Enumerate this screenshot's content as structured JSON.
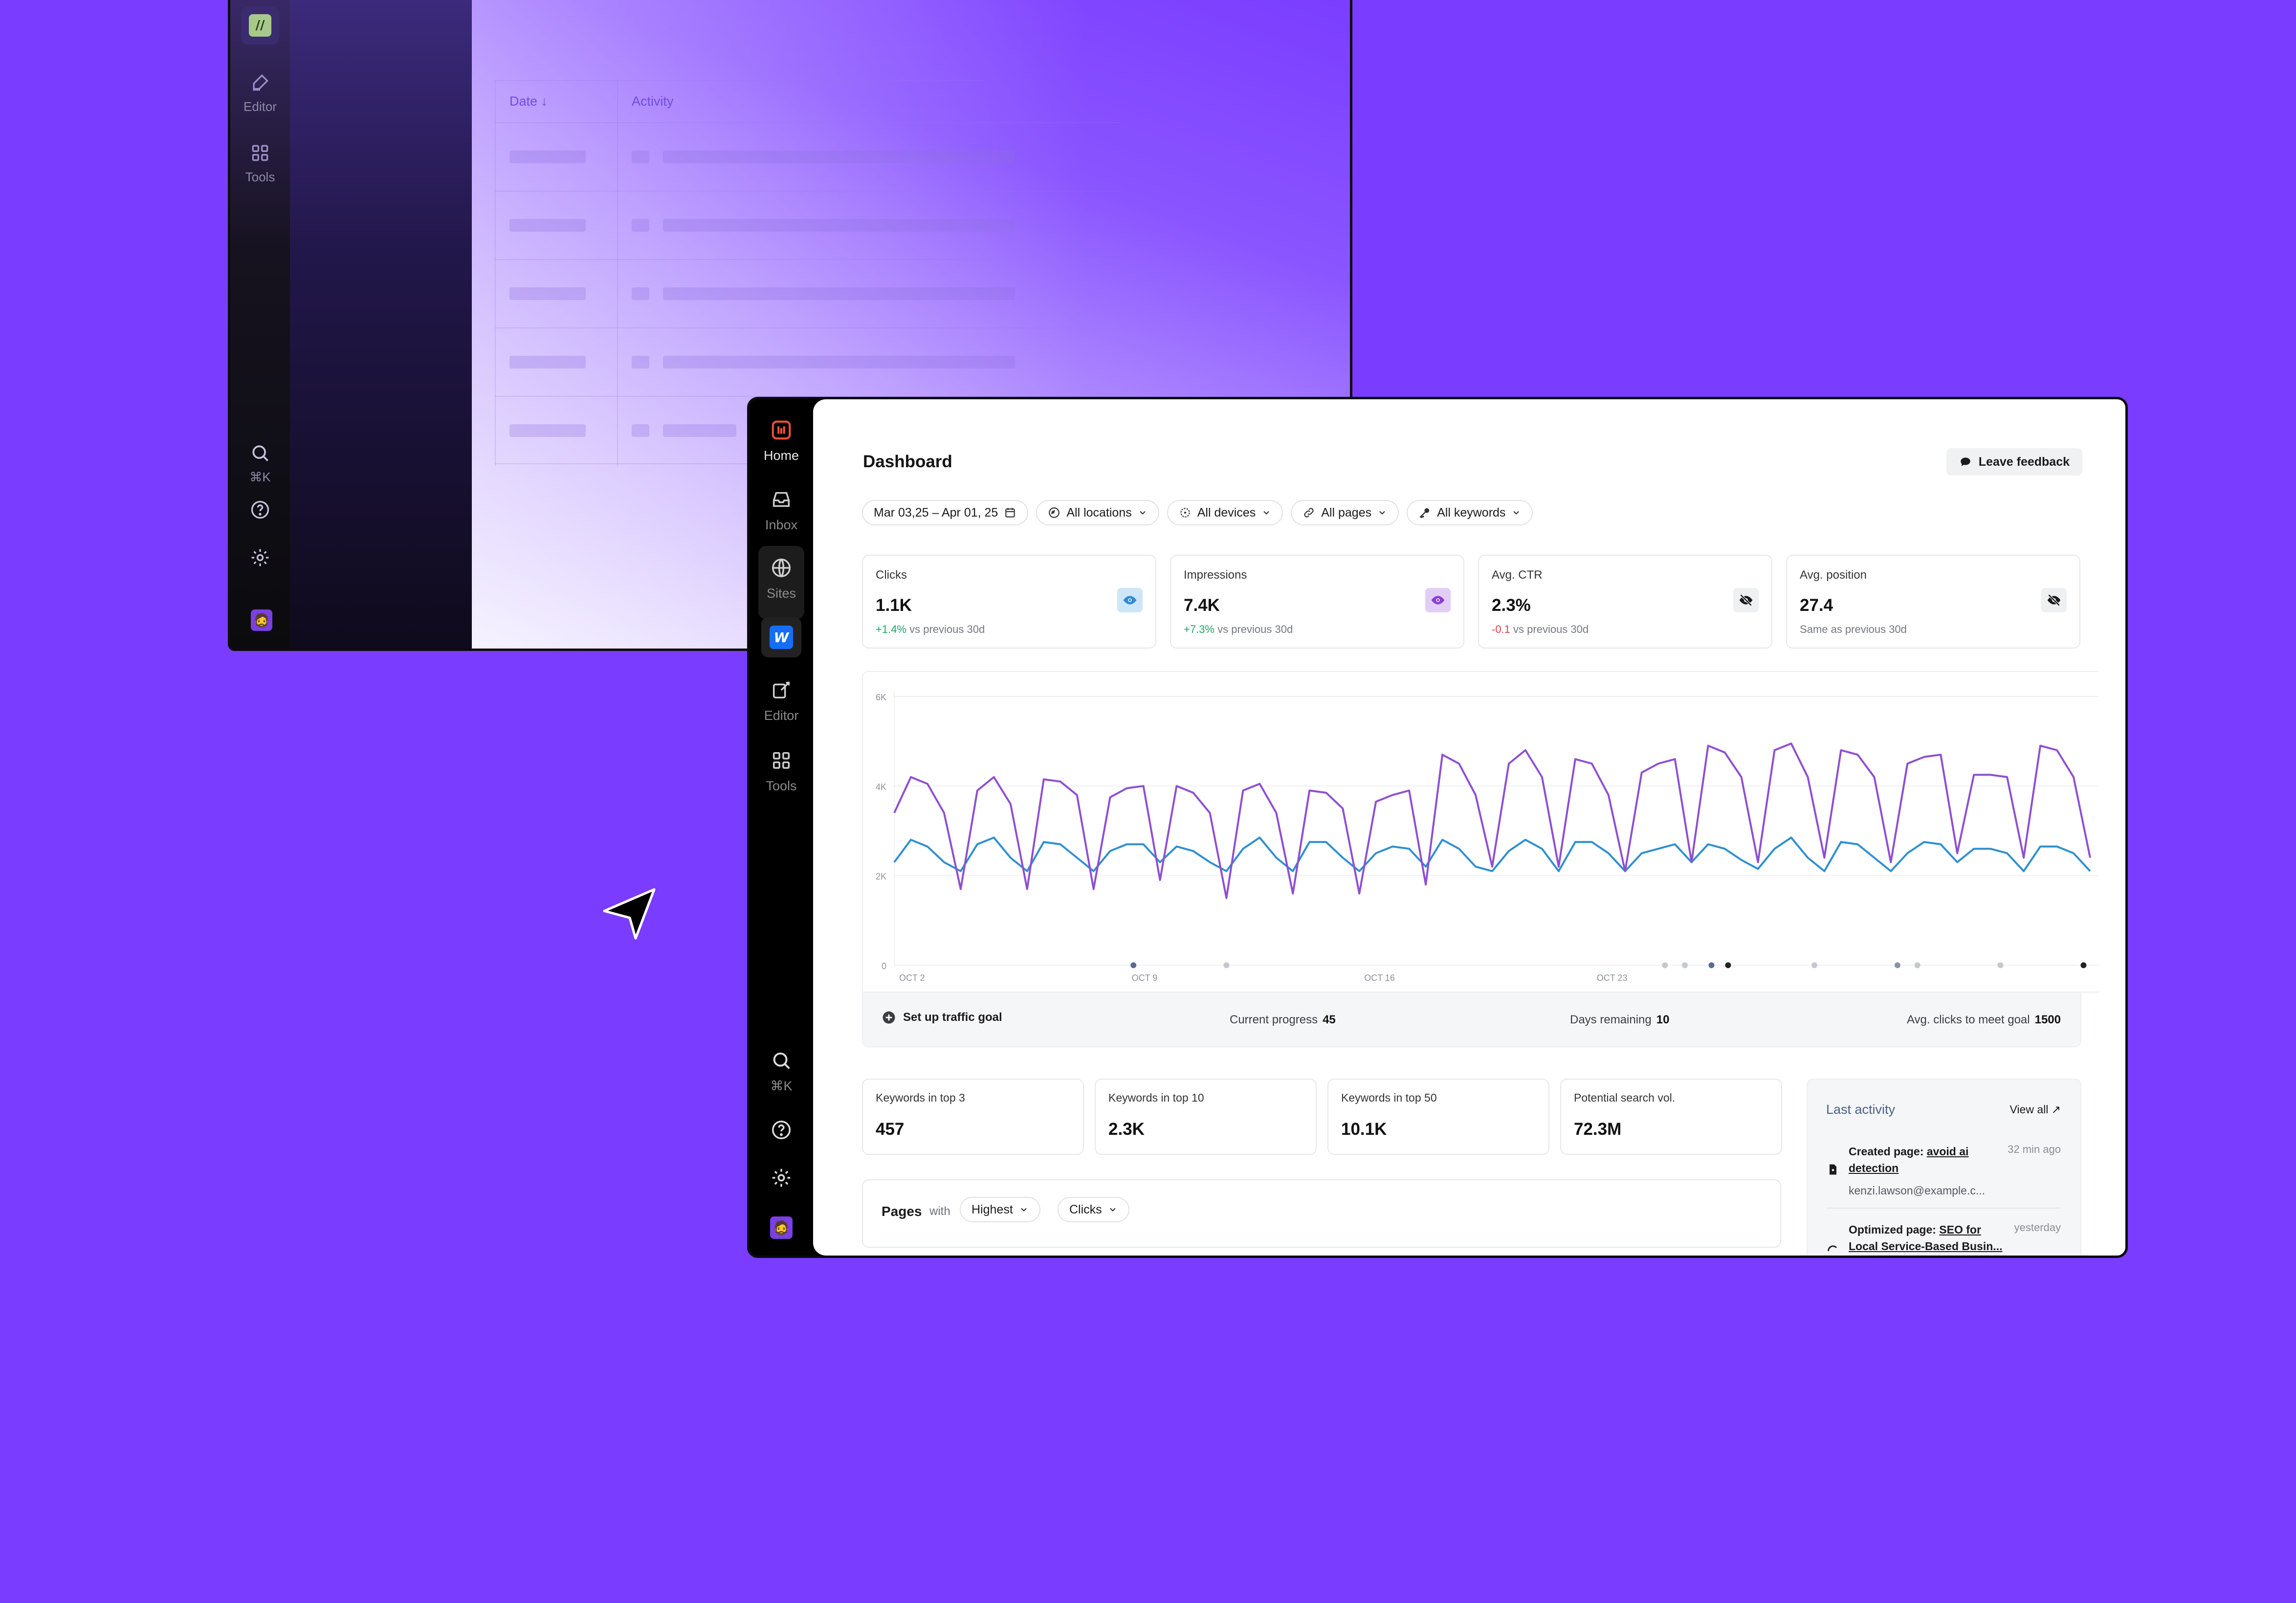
{
  "back_window": {
    "rail": {
      "editor_label": "Editor",
      "tools_label": "Tools",
      "shortcut": "⌘K"
    },
    "table": {
      "col_date": "Date",
      "col_activity": "Activity"
    }
  },
  "rail": {
    "home": "Home",
    "inbox": "Inbox",
    "sites": "Sites",
    "editor": "Editor",
    "tools": "Tools",
    "shortcut": "⌘K"
  },
  "header": {
    "title": "Dashboard",
    "feedback": "Leave feedback"
  },
  "filters": {
    "date_range": "Mar 03,25 – Apr 01, 25",
    "locations": "All locations",
    "devices": "All devices",
    "pages": "All pages",
    "keywords": "All keywords"
  },
  "metrics": [
    {
      "label": "Clicks",
      "value": "1.1K",
      "delta": "+1.4%",
      "delta_suffix": " vs previous 30d",
      "visible": true,
      "color": "#2d8bd6"
    },
    {
      "label": "Impressions",
      "value": "7.4K",
      "delta": "+7.3%",
      "delta_suffix": " vs previous 30d",
      "visible": true,
      "color": "#8a3fd0"
    },
    {
      "label": "Avg. CTR",
      "value": "2.3%",
      "delta": "-0.1",
      "delta_suffix": " vs previous 30d",
      "visible": false
    },
    {
      "label": "Avg. position",
      "value": "27.4",
      "delta": "",
      "delta_suffix": "Same as previous 30d",
      "visible": false
    }
  ],
  "chart_data": {
    "type": "line",
    "y_ticks": [
      "0",
      "2K",
      "4K",
      "6K"
    ],
    "ylim": [
      0,
      6000
    ],
    "x_tick_labels": [
      "OCT 2",
      "OCT 9",
      "OCT 16",
      "OCT 23"
    ],
    "grid": true,
    "series": [
      {
        "color": "#8f4fd1",
        "values": [
          3400,
          4200,
          4050,
          3400,
          1700,
          3900,
          4200,
          3600,
          1700,
          4150,
          4100,
          3800,
          1700,
          3750,
          3950,
          4000,
          1900,
          4000,
          3850,
          3400,
          1500,
          3900,
          4050,
          3400,
          1600,
          3900,
          3850,
          3500,
          1600,
          3650,
          3800,
          3900,
          1800,
          4700,
          4500,
          3800,
          2200,
          4500,
          4800,
          4200,
          2200,
          4600,
          4500,
          3800,
          2100,
          4300,
          4500,
          4600,
          2300,
          4900,
          4750,
          4200,
          2300,
          4800,
          4950,
          4200,
          2400,
          4800,
          4700,
          4200,
          2300,
          4500,
          4650,
          4700,
          2500,
          4250,
          4250,
          4200,
          2400,
          4900,
          4800,
          4200,
          2400
        ]
      },
      {
        "color": "#2f8fd0",
        "values": [
          2300,
          2800,
          2650,
          2300,
          2100,
          2700,
          2850,
          2400,
          2100,
          2750,
          2700,
          2400,
          2100,
          2550,
          2700,
          2700,
          2300,
          2650,
          2550,
          2300,
          2100,
          2600,
          2850,
          2400,
          2100,
          2750,
          2750,
          2400,
          2100,
          2500,
          2650,
          2600,
          2200,
          2800,
          2600,
          2200,
          2100,
          2550,
          2800,
          2600,
          2100,
          2750,
          2750,
          2500,
          2100,
          2500,
          2600,
          2700,
          2300,
          2700,
          2600,
          2350,
          2150,
          2600,
          2850,
          2400,
          2100,
          2750,
          2700,
          2400,
          2100,
          2500,
          2750,
          2700,
          2300,
          2600,
          2600,
          2500,
          2100,
          2650,
          2650,
          2500,
          2100
        ]
      }
    ],
    "annotation_dots": [
      {
        "day": 7.2,
        "color": "#5b6b8f"
      },
      {
        "day": 10,
        "color": "#c4c8d0"
      },
      {
        "day": 23.2,
        "color": "#c4c8d0"
      },
      {
        "day": 23.8,
        "color": "#c4c8d0"
      },
      {
        "day": 24.6,
        "color": "#5b6b8f"
      },
      {
        "day": 25.1,
        "color": "#222222"
      },
      {
        "day": 27.7,
        "color": "#c4c8d0"
      },
      {
        "day": 30.2,
        "color": "#8a93a8"
      },
      {
        "day": 30.8,
        "color": "#c4c8d0"
      },
      {
        "day": 33.3,
        "color": "#c4c8d0"
      },
      {
        "day": 35.8,
        "color": "#222222"
      }
    ]
  },
  "goal": {
    "setup": "Set up traffic goal",
    "progress_label": "Current progress",
    "progress_value": "45",
    "days_label": "Days remaining",
    "days_value": "10",
    "avg_label": "Avg. clicks to meet goal",
    "avg_value": "1500"
  },
  "keywords": [
    {
      "label": "Keywords in top 3",
      "value": "457"
    },
    {
      "label": "Keywords in top 10",
      "value": "2.3K"
    },
    {
      "label": "Keywords in top 50",
      "value": "10.1K"
    },
    {
      "label": "Potential search vol.",
      "value": "72.3M"
    }
  ],
  "pages": {
    "title": "Pages",
    "with": "with",
    "sort": "Highest",
    "metric": "Clicks"
  },
  "activity": {
    "title": "Last activity",
    "view_all": "View all ↗",
    "items": [
      {
        "prefix": "Created page: ",
        "link": "avoid ai detection",
        "when": "32 min ago",
        "email": "kenzi.lawson@example.c..."
      },
      {
        "prefix": "Optimized page: ",
        "link": "SEO for Local Service-Based Busin...",
        "when": "yesterday"
      }
    ]
  }
}
